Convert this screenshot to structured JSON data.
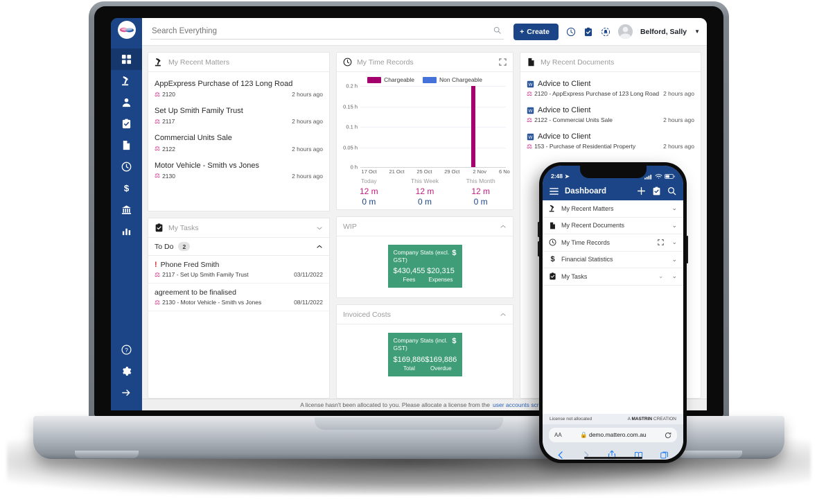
{
  "app": {
    "logo_name": "mattero-logo",
    "search": {
      "placeholder": "Search Everything",
      "value": ""
    },
    "create_button": "Create",
    "user": {
      "name": "Belford, Sally"
    },
    "footer": {
      "text": "A license hasn't been allocated to you. Please allocate a license from the",
      "link": "user accounts screen"
    }
  },
  "sidebar": {
    "items": [
      {
        "label": "Dashboard",
        "icon": "grid-icon",
        "active": true
      },
      {
        "label": "Matters",
        "icon": "gavel-icon",
        "active": false
      },
      {
        "label": "Contacts",
        "icon": "person-icon",
        "active": false
      },
      {
        "label": "Tasks",
        "icon": "clipboard-check-icon",
        "active": false
      },
      {
        "label": "Documents",
        "icon": "document-icon",
        "active": false
      },
      {
        "label": "Time",
        "icon": "clock-icon",
        "active": false
      },
      {
        "label": "Billing",
        "icon": "dollar-icon",
        "active": false
      },
      {
        "label": "Trust",
        "icon": "bank-icon",
        "active": false
      },
      {
        "label": "Reports",
        "icon": "bar-chart-icon",
        "active": false
      }
    ],
    "bottom_items": [
      {
        "label": "Help",
        "icon": "help-circle-icon"
      },
      {
        "label": "Settings",
        "icon": "gear-icon"
      },
      {
        "label": "Expand",
        "icon": "arrow-right-icon"
      }
    ]
  },
  "cards": {
    "recent_matters": {
      "title": "My Recent Matters",
      "icon": "gavel-icon",
      "items": [
        {
          "name": "AppExpress Purchase of 123 Long Road",
          "number": "2120",
          "time": "2 hours ago"
        },
        {
          "name": "Set Up Smith Family Trust",
          "number": "2117",
          "time": "2 hours ago"
        },
        {
          "name": "Commercial Units Sale",
          "number": "2122",
          "time": "2 hours ago"
        },
        {
          "name": "Motor Vehicle - Smith vs Jones",
          "number": "2130",
          "time": "2 hours ago"
        }
      ]
    },
    "my_tasks": {
      "title": "My Tasks",
      "icon": "clipboard-check-icon",
      "section": {
        "label": "To Do",
        "count": "2"
      },
      "items": [
        {
          "priority": "!",
          "name": "Phone Fred Smith",
          "matter": "2117 - Set Up Smith Family Trust",
          "due": "03/11/2022"
        },
        {
          "priority": "",
          "name": "agreement to be finalised",
          "matter": "2130 - Motor Vehicle - Smith vs Jones",
          "due": "08/11/2022"
        }
      ]
    },
    "time_records": {
      "title": "My Time Records",
      "icon": "clock-icon",
      "expand_icon": "expand-icon",
      "summary": [
        {
          "period": "Today",
          "chargeable": "12 m",
          "non_chargeable": "0 m"
        },
        {
          "period": "This Week",
          "chargeable": "12 m",
          "non_chargeable": "0 m"
        },
        {
          "period": "This Month",
          "chargeable": "12 m",
          "non_chargeable": "0 m"
        }
      ]
    },
    "wip": {
      "title": "WIP",
      "collapse_icon": "chevron-up-icon",
      "stat": {
        "title": "Company Stats (excl. GST)",
        "currency": "$",
        "cells": [
          {
            "value": "$430,455",
            "caption": "Fees"
          },
          {
            "value": "$20,315",
            "caption": "Expenses"
          }
        ]
      }
    },
    "invoiced_costs": {
      "title": "Invoiced Costs",
      "collapse_icon": "chevron-up-icon",
      "stat": {
        "title": "Company Stats (incl. GST)",
        "currency": "$",
        "cells": [
          {
            "value": "$169,886",
            "caption": "Total"
          },
          {
            "value": "$169,886",
            "caption": "Overdue"
          }
        ]
      }
    },
    "recent_documents": {
      "title": "My Recent Documents",
      "icon": "document-icon",
      "items": [
        {
          "name": "Advice to Client",
          "matter": "2120 - AppExpress Purchase of 123 Long Road",
          "time": "2 hours ago"
        },
        {
          "name": "Advice to Client",
          "matter": "2122 - Commercial Units Sale",
          "time": "2 hours ago"
        },
        {
          "name": "Advice to Client",
          "matter": "153 - Purchase of Residential Property",
          "time": "2 hours ago"
        }
      ]
    }
  },
  "chart_data": {
    "type": "bar",
    "title": "My Time Records",
    "xlabel": "",
    "ylabel": "",
    "ylim": [
      0,
      0.2
    ],
    "ytick_labels": [
      "0 h",
      "0.05 h",
      "0.1 h",
      "0.15 h",
      "0.2 h"
    ],
    "ytick_values": [
      0,
      0.05,
      0.1,
      0.15,
      0.2
    ],
    "xtick_labels": [
      "17 Oct",
      "21 Oct",
      "25 Oct",
      "29 Oct",
      "2 Nov",
      "6 No"
    ],
    "grid": true,
    "legend_position": "top",
    "series": [
      {
        "name": "Chargeable",
        "color": "#a3006e",
        "points": [
          {
            "x": "1 Nov",
            "y": 0.2
          }
        ]
      },
      {
        "name": "Non Chargeable",
        "color": "#4472d8",
        "points": []
      }
    ]
  },
  "colors": {
    "brand_blue": "#1b4586",
    "chargeable": "#a3006e",
    "non_chargeable": "#4472d8",
    "stat_green": "#3f9d77",
    "priority_red": "#d32f2f"
  },
  "phone": {
    "status": {
      "time": "2:48",
      "location_icon": "location-arrow-icon",
      "signal_icon": "cellular-icon",
      "wifi_icon": "wifi-icon",
      "battery_icon": "battery-icon"
    },
    "header": {
      "menu_icon": "hamburger-icon",
      "title": "Dashboard",
      "add_icon": "plus-icon",
      "tasks_icon": "clipboard-check-icon",
      "search_icon": "search-icon"
    },
    "rows": [
      {
        "label": "My Recent Matters",
        "icon": "gavel-icon",
        "chevron": "chevron-down-icon",
        "expand": false
      },
      {
        "label": "My Recent Documents",
        "icon": "document-icon",
        "chevron": "chevron-down-icon",
        "expand": false
      },
      {
        "label": "My Time Records",
        "icon": "clock-icon",
        "chevron": "chevron-down-icon",
        "expand": true
      },
      {
        "label": "Financial Statistics",
        "icon": "dollar-icon",
        "chevron": "chevron-down-icon",
        "expand": false
      },
      {
        "label": "My Tasks",
        "icon": "clipboard-check-icon",
        "chevron": "chevron-down-icon",
        "expand": false
      }
    ],
    "footer_note": {
      "license": "License not allocated",
      "brand_prefix": "A ",
      "brand": "MASTRIN",
      "brand_suffix": " CREATION"
    },
    "browser": {
      "aa": "AA",
      "lock_icon": "lock-icon",
      "url": "demo.mattero.com.au",
      "reload_icon": "reload-icon"
    },
    "toolbar": [
      "back-icon",
      "forward-icon",
      "share-icon",
      "bookmarks-icon",
      "tabs-icon"
    ]
  }
}
